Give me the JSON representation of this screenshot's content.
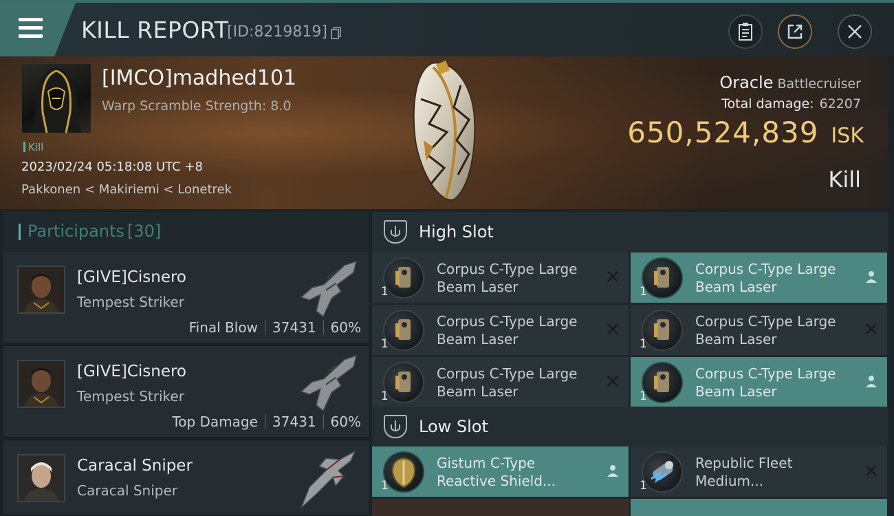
{
  "header": {
    "title": "KILL REPORT",
    "report_id": "[ID:8219819]"
  },
  "victim": {
    "name": "[IMCO]madhed101",
    "warp_scramble": "Warp Scramble Strength: 8.0",
    "tag": "Kill",
    "datetime": "2023/02/24 05:18:08 UTC +8",
    "location": "Pakkonen < Makiriemi < Lonetrek",
    "ship_name": "Oracle",
    "ship_class": "Battlecruiser",
    "total_damage_label": "Total damage:",
    "total_damage": "62207",
    "isk_value": "650,524,839",
    "isk_unit": "ISK",
    "result": "Kill"
  },
  "participants": {
    "title": "Participants",
    "count": "[30]",
    "items": [
      {
        "name": "[GIVE]Cisnero",
        "ship": "Tempest Striker",
        "role": "Final Blow",
        "damage": "37431",
        "percent": "60%"
      },
      {
        "name": "[GIVE]Cisnero",
        "ship": "Tempest Striker",
        "role": "Top Damage",
        "damage": "37431",
        "percent": "60%"
      },
      {
        "name": "Caracal Sniper",
        "ship": "Caracal Sniper"
      }
    ]
  },
  "fitting": {
    "high_slot": {
      "title": "High Slot",
      "modules": [
        {
          "qty": "1",
          "name": "Corpus C-Type Large Beam Laser",
          "flag": "destroyed"
        },
        {
          "qty": "1",
          "name": "Corpus C-Type Large Beam Laser",
          "flag": "dropped"
        },
        {
          "qty": "1",
          "name": "Corpus C-Type Large Beam Laser",
          "flag": "destroyed"
        },
        {
          "qty": "1",
          "name": "Corpus C-Type Large Beam Laser",
          "flag": "destroyed"
        },
        {
          "qty": "1",
          "name": "Corpus C-Type Large Beam Laser",
          "flag": "destroyed"
        },
        {
          "qty": "1",
          "name": "Corpus C-Type Large Beam Laser",
          "flag": "dropped"
        }
      ]
    },
    "low_slot": {
      "title": "Low Slot",
      "modules": [
        {
          "qty": "1",
          "name": "Gistum C-Type Reactive Shield...",
          "flag": "dropped"
        },
        {
          "qty": "1",
          "name": "Republic Fleet Medium...",
          "flag": "destroyed"
        }
      ]
    }
  },
  "colors": {
    "accent_teal": "#4fb3a8",
    "isk_gold": "#f0c97a",
    "dropped_row": "#4d8782"
  }
}
